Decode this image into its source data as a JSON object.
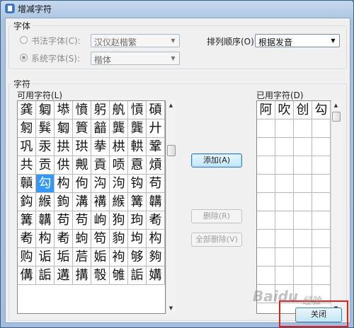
{
  "dialog": {
    "title": "增减字符",
    "close_label": "关闭"
  },
  "font_group": {
    "title": "字体",
    "calligraphy": {
      "label": "书法字体(C):",
      "value": "汉仪赵楷繁",
      "selected": false
    },
    "system": {
      "label": "系统字体(S):",
      "value": "楷体",
      "selected": true
    },
    "sort": {
      "label": "排列顺序(O):",
      "value": "根据发音"
    }
  },
  "char_group": {
    "title": "字符",
    "available_label": "可用字符(L)",
    "used_label": "已用字符(D)",
    "available_chars": [
      [
        "龚",
        "匔",
        "塨",
        "憤",
        "躬",
        "舧",
        "愩",
        "碽"
      ],
      [
        "匑",
        "髸",
        "匔",
        "篢",
        "韽",
        "龔",
        "龔",
        "廾"
      ],
      [
        "巩",
        "汞",
        "拱",
        "珙",
        "拲",
        "栱",
        "輁",
        "鞏"
      ],
      [
        "共",
        "贡",
        "供",
        "觍",
        "貢",
        "唝",
        "慐",
        "熕"
      ],
      [
        "贑",
        "勾",
        "构",
        "佝",
        "沟",
        "泃",
        "钩",
        "苟"
      ],
      [
        "鈎",
        "緱",
        "鉤",
        "溝",
        "褠",
        "緱",
        "篝",
        "韝"
      ],
      [
        "篝",
        "韝",
        "苟",
        "苟",
        "岣",
        "狗",
        "玽",
        "耇"
      ],
      [
        "耇",
        "构",
        "耇",
        "蚼",
        "笱",
        "豿",
        "坸",
        "构"
      ],
      [
        "购",
        "诟",
        "垢",
        "茩",
        "姤",
        "袧",
        "够",
        "夠"
      ],
      [
        "傋",
        "詬",
        "遘",
        "搆",
        "彀",
        "雊",
        "詬",
        "媾"
      ]
    ],
    "selected_char": "勾",
    "used_chars": [
      "阿",
      "吹",
      "创",
      "勾"
    ],
    "add_button": "添加(A)",
    "delete_button": "删除(R)",
    "delete_all_button": "全部删除(V)"
  },
  "watermark": {
    "brand": "Baidu",
    "sub": "经验"
  }
}
